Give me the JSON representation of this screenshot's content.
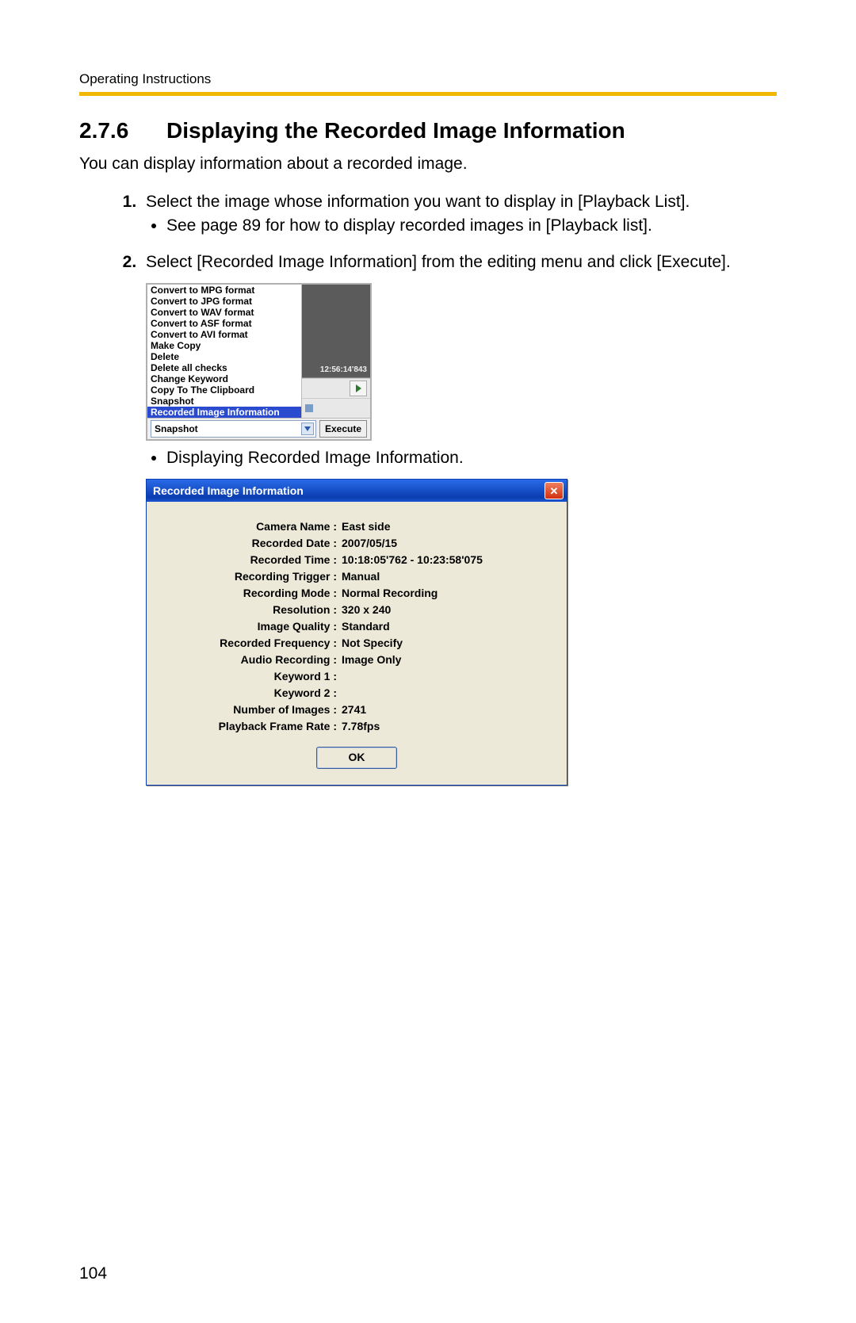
{
  "header": "Operating Instructions",
  "section_number": "2.7.6",
  "section_title": "Displaying the Recorded Image Information",
  "intro": "You can display information about a recorded image.",
  "step1": "Select the image whose information you want to display in [Playback List].",
  "step1_bullet": "See page 89 for how to display recorded images in [Playback list].",
  "step2": "Select [Recorded Image Information] from the editing menu and click [Execute].",
  "step2_bullet": "Displaying Recorded Image Information.",
  "menu": {
    "items": [
      "Convert to MPG format",
      "Convert to JPG format",
      "Convert to WAV format",
      "Convert to ASF format",
      "Convert to AVI format",
      "Make Copy",
      "Delete",
      "Delete all checks",
      "Change Keyword",
      "Copy To The Clipboard",
      "Snapshot"
    ],
    "selected": "Recorded Image Information",
    "timestamp": "12:56:14'843",
    "combo_value": "Snapshot",
    "execute": "Execute"
  },
  "dialog": {
    "title": "Recorded Image Information",
    "fields": [
      {
        "label": "Camera Name :",
        "value": "East side"
      },
      {
        "label": "Recorded Date :",
        "value": "2007/05/15"
      },
      {
        "label": "Recorded Time :",
        "value": "10:18:05'762 - 10:23:58'075"
      },
      {
        "label": "Recording Trigger :",
        "value": "Manual"
      },
      {
        "label": "Recording Mode :",
        "value": "Normal Recording"
      },
      {
        "label": "Resolution :",
        "value": "320 x 240"
      },
      {
        "label": "Image Quality :",
        "value": "Standard"
      },
      {
        "label": "Recorded Frequency :",
        "value": "Not Specify"
      },
      {
        "label": "Audio Recording :",
        "value": "Image Only"
      },
      {
        "label": "Keyword 1 :",
        "value": ""
      },
      {
        "label": "Keyword 2 :",
        "value": ""
      },
      {
        "label": "Number of Images :",
        "value": "2741"
      },
      {
        "label": "Playback Frame Rate :",
        "value": "7.78fps"
      }
    ],
    "ok": "OK"
  },
  "page_number": "104"
}
